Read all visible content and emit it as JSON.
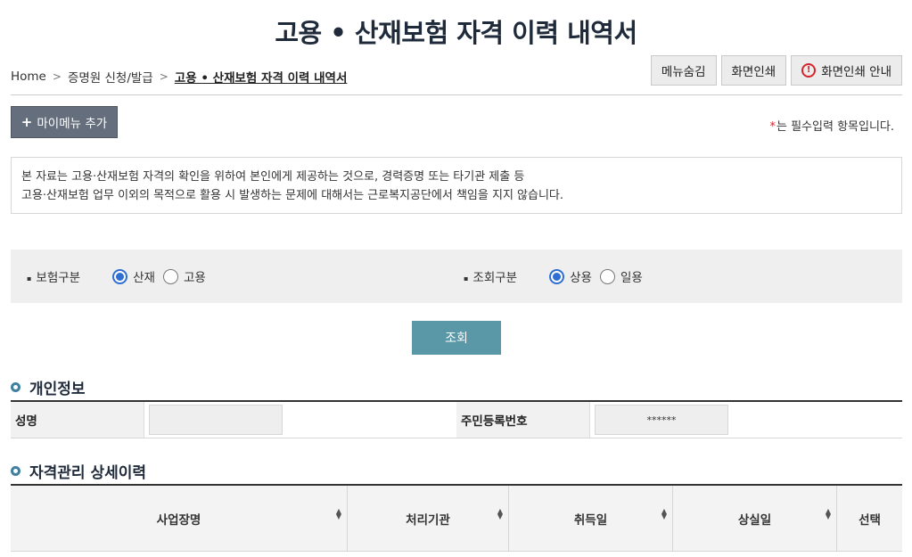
{
  "page_title": "고용 • 산재보험 자격 이력 내역서",
  "breadcrumb": {
    "home": "Home",
    "level1": "증명원 신청/발급",
    "current": "고용 • 산재보험 자격 이력 내역서"
  },
  "top_buttons": {
    "hide_menu": "메뉴숨김",
    "print": "화면인쇄",
    "print_guide": "화면인쇄 안내"
  },
  "mymenu_add": "마이메뉴 추가",
  "required_note": {
    "star": "*",
    "text": "는 필수입력 항목입니다."
  },
  "notice": {
    "line1": "본 자료는 고용·산재보험 자격의 확인을 위하여 본인에게 제공하는 것으로, 경력증명 또는 타기관 제출 등",
    "line2": "고용·산재보험 업무 이외의 목적으로 활용 시 발생하는 문제에 대해서는 근로복지공단에서 책임을 지지 않습니다."
  },
  "search": {
    "insurance_type": {
      "label": "보험구분",
      "options": [
        "산재",
        "고용"
      ],
      "selected": "산재"
    },
    "inquiry_type": {
      "label": "조회구분",
      "options": [
        "상용",
        "일용"
      ],
      "selected": "상용"
    },
    "submit_label": "조회"
  },
  "personal_info": {
    "title": "개인정보",
    "name_label": "성명",
    "name_value": "",
    "rrn_label": "주민등록번호",
    "rrn_value": "******"
  },
  "detail_history": {
    "title": "자격관리 상세이력",
    "columns": [
      "사업장명",
      "처리기관",
      "취득일",
      "상실일",
      "선택"
    ]
  },
  "colors": {
    "accent_blue": "#2f6fd1",
    "search_button": "#5a98a8",
    "mymenu_button": "#656e7c",
    "warning_red": "#d5252c"
  }
}
